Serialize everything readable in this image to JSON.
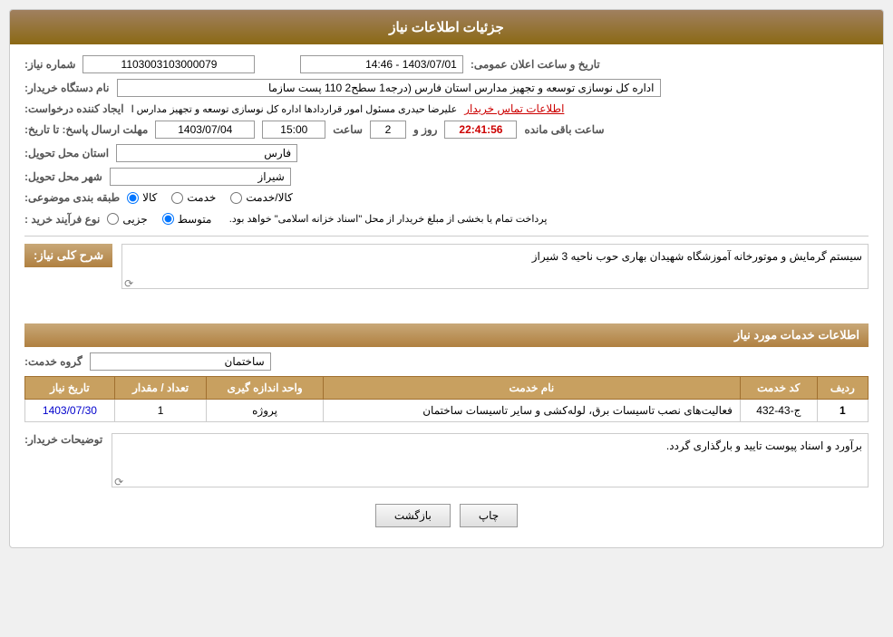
{
  "header": {
    "title": "جزئیات اطلاعات نیاز"
  },
  "fields": {
    "shomareNiaz_label": "شماره نیاز:",
    "shomareNiaz_value": "1103003103000079",
    "namDastgah_label": "نام دستگاه خریدار:",
    "namDastgah_value": "اداره کل نوسازی   توسعه و تجهیز مدارس استان فارس (درجه1  سطح2  110 پست سازما",
    "ijadKonande_label": "ایجاد کننده درخواست:",
    "ijadKonande_value": "علیرضا حیدری مسئول امور قراردادها اداره کل نوسازی   توسعه و تجهیز مدارس ا",
    "ijadKonande_link": "اطلاعات تماس خریدار",
    "mohlatErsal_label": "مهلت ارسال پاسخ: تا تاریخ:",
    "tarikh_value": "1403/07/04",
    "saat_label": "ساعت",
    "saat_value": "15:00",
    "rooz_label": "روز و",
    "rooz_value": "2",
    "countdown_value": "22:41:56",
    "countdown_label": "ساعت باقی مانده",
    "ostan_label": "استان محل تحویل:",
    "ostan_value": "فارس",
    "shahr_label": "شهر محل تحویل:",
    "shahr_value": "شیراز",
    "tabaghe_label": "طبقه بندی موضوعی:",
    "tabaghe_options": [
      "کالا",
      "خدمت",
      "کالا/خدمت"
    ],
    "tabaghe_selected": "کالا",
    "noeFarayand_label": "نوع فرآیند خرید :",
    "noeFarayand_options": [
      "جزیی",
      "متوسط"
    ],
    "noeFarayand_selected": "متوسط",
    "noeFarayand_note": "پرداخت تمام یا بخشی از مبلغ خریدار از محل \"اسناد خزانه اسلامی\" خواهد بود.",
    "tarikh_alanomumi_label": "تاریخ و ساعت اعلان عمومی:",
    "tarikh_alanomumi_value": "1403/07/01 - 14:46",
    "sharhKoli_section": "شرح کلی نیاز:",
    "sharhKoli_value": "سیستم گرمایش و موتورخانه آموزشگاه شهیدان بهاری حوب ناحیه 3 شیراز",
    "khadamat_section": "اطلاعات خدمات مورد نیاز",
    "groheKhadamat_label": "گروه خدمت:",
    "groheKhadamat_value": "ساختمان",
    "table": {
      "columns": [
        "ردیف",
        "کد خدمت",
        "نام خدمت",
        "واحد اندازه گیری",
        "تعداد / مقدار",
        "تاریخ نیاز"
      ],
      "rows": [
        {
          "radif": "1",
          "kodKhadamat": "ج-43-432",
          "namKhadamat": "فعالیت‌های نصب تاسیسات برق، لوله‌کشی و سایر تاسیسات ساختمان",
          "vahed": "پروژه",
          "tedad": "1",
          "tarikh": "1403/07/30"
        }
      ]
    },
    "buyer_notes_label": "توضیحات خریدار:",
    "buyer_notes_value": "برآورد و اسناد پیوست تایید و بارگذاری گردد."
  },
  "buttons": {
    "print_label": "چاپ",
    "back_label": "بازگشت"
  }
}
